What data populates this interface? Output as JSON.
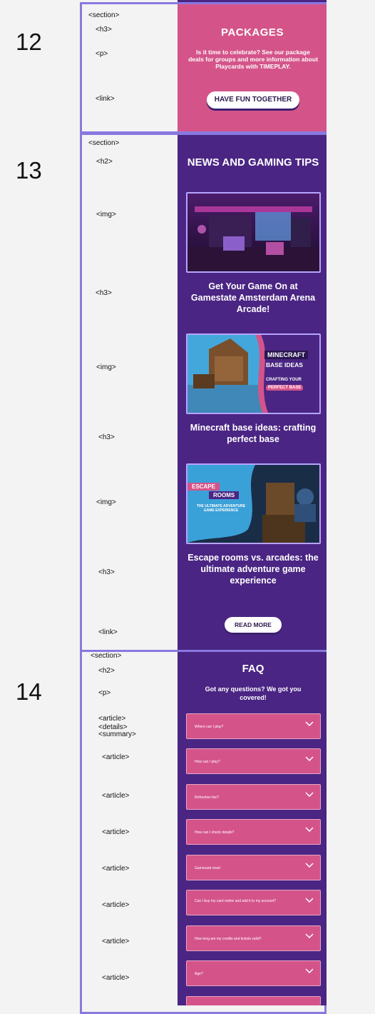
{
  "section_numbers": [
    "12",
    "13",
    "14"
  ],
  "tags": {
    "s12": [
      "<section>",
      "<h3>",
      "<p>",
      "<link>"
    ],
    "s13": [
      "<section>",
      "<h2>",
      "<img>",
      "<h3>",
      "<img>",
      "<h3>",
      "<img>",
      "<h3>",
      "<link>"
    ],
    "s14": [
      "<section>",
      "<h2>",
      "<p>",
      "<article>",
      "<details>",
      "<summary>",
      "<article>",
      "<article>",
      "<article>",
      "<article>",
      "<article>",
      "<article>",
      "<article>"
    ]
  },
  "packages": {
    "title": "PACKAGES",
    "text": "Is it time to celebrate? See our package deals for groups and more information about Playcards with TIMEPLAY.",
    "button": "HAVE FUN TOGETHER"
  },
  "news": {
    "title": "NEWS AND GAMING TIPS",
    "articles": [
      {
        "title": "Get Your Game On at Gamestate Amsterdam Arena Arcade!",
        "image": "arcade-photo"
      },
      {
        "title": "Minecraft base ideas: crafting perfect base",
        "image": "minecraft-photo",
        "overlay": [
          "MINECRAFT",
          "BASE IDEAS",
          "CRAFTING YOUR",
          "PERFECT BASE"
        ]
      },
      {
        "title": "Escape rooms vs. arcades: the ultimate adventure game experience",
        "image": "escape-room-photo",
        "overlay": [
          "ESCAPE",
          "ROOMS",
          "THE ULTIMATE ADVENTURE GAME EXPERIENCE"
        ]
      }
    ],
    "button": "READ MORE"
  },
  "faq": {
    "title": "FAQ",
    "subtitle": "Got any questions? We got you covered!",
    "questions": [
      "Where can I play?",
      "How can I play?",
      "Refreshes fee?",
      "How can I check details?",
      "Gamecard reset",
      "Can I buy my card online and add it to my account?",
      "How long are my credits and tickets valid?",
      "Age?"
    ]
  },
  "colors": {
    "pink": "#d4548a",
    "purple": "#4a2583",
    "frame": "#8a78e0"
  }
}
